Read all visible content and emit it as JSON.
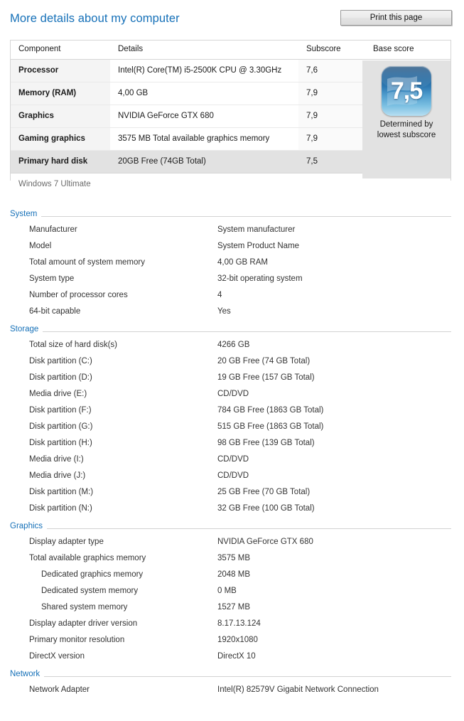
{
  "header": {
    "title": "More details about my computer",
    "print_button": "Print this page"
  },
  "score_table": {
    "columns": {
      "component": "Component",
      "details": "Details",
      "subscore": "Subscore",
      "base_score": "Base score"
    },
    "rows": [
      {
        "component": "Processor",
        "details": "Intel(R) Core(TM) i5-2500K CPU @ 3.30GHz",
        "subscore": "7,6",
        "highlight": false
      },
      {
        "component": "Memory (RAM)",
        "details": "4,00 GB",
        "subscore": "7,9",
        "highlight": false
      },
      {
        "component": "Graphics",
        "details": "NVIDIA GeForce GTX 680",
        "subscore": "7,9",
        "highlight": false
      },
      {
        "component": "Gaming graphics",
        "details": "3575 MB Total available graphics memory",
        "subscore": "7,9",
        "highlight": false
      },
      {
        "component": "Primary hard disk",
        "details": "20GB Free (74GB Total)",
        "subscore": "7,5",
        "highlight": true
      }
    ],
    "base_score_value": "7,5",
    "base_score_caption": "Determined by lowest subscore",
    "edition": "Windows 7 Ultimate"
  },
  "sections": [
    {
      "title": "System",
      "rows": [
        {
          "label": "Manufacturer",
          "value": "System manufacturer",
          "indent": false
        },
        {
          "label": "Model",
          "value": "System Product Name",
          "indent": false
        },
        {
          "label": "Total amount of system memory",
          "value": "4,00 GB RAM",
          "indent": false
        },
        {
          "label": "System type",
          "value": "32-bit operating system",
          "indent": false
        },
        {
          "label": "Number of processor cores",
          "value": "4",
          "indent": false
        },
        {
          "label": "64-bit capable",
          "value": "Yes",
          "indent": false
        }
      ]
    },
    {
      "title": "Storage",
      "rows": [
        {
          "label": "Total size of hard disk(s)",
          "value": "4266 GB",
          "indent": false
        },
        {
          "label": "Disk partition (C:)",
          "value": "20 GB Free (74 GB Total)",
          "indent": false
        },
        {
          "label": "Disk partition (D:)",
          "value": "19 GB Free (157 GB Total)",
          "indent": false
        },
        {
          "label": "Media drive (E:)",
          "value": "CD/DVD",
          "indent": false
        },
        {
          "label": "Disk partition (F:)",
          "value": "784 GB Free (1863 GB Total)",
          "indent": false
        },
        {
          "label": "Disk partition (G:)",
          "value": "515 GB Free (1863 GB Total)",
          "indent": false
        },
        {
          "label": "Disk partition (H:)",
          "value": "98 GB Free (139 GB Total)",
          "indent": false
        },
        {
          "label": "Media drive (I:)",
          "value": "CD/DVD",
          "indent": false
        },
        {
          "label": "Media drive (J:)",
          "value": "CD/DVD",
          "indent": false
        },
        {
          "label": "Disk partition (M:)",
          "value": "25 GB Free (70 GB Total)",
          "indent": false
        },
        {
          "label": "Disk partition (N:)",
          "value": "32 GB Free (100 GB Total)",
          "indent": false
        }
      ]
    },
    {
      "title": "Graphics",
      "rows": [
        {
          "label": "Display adapter type",
          "value": "NVIDIA GeForce GTX 680",
          "indent": false
        },
        {
          "label": "Total available graphics memory",
          "value": "3575 MB",
          "indent": false
        },
        {
          "label": "Dedicated graphics memory",
          "value": "2048 MB",
          "indent": true
        },
        {
          "label": "Dedicated system memory",
          "value": "0 MB",
          "indent": true
        },
        {
          "label": "Shared system memory",
          "value": "1527 MB",
          "indent": true
        },
        {
          "label": "Display adapter driver version",
          "value": "8.17.13.124",
          "indent": false
        },
        {
          "label": "Primary monitor resolution",
          "value": "1920x1080",
          "indent": false
        },
        {
          "label": "DirectX version",
          "value": "DirectX 10",
          "indent": false
        }
      ]
    },
    {
      "title": "Network",
      "rows": [
        {
          "label": "Network Adapter",
          "value": "Intel(R) 82579V Gigabit Network Connection",
          "indent": false
        }
      ]
    }
  ],
  "colors": {
    "link_blue": "#1570b8",
    "badge_blue": "#13568f",
    "highlight_gray": "#e2e2e2"
  }
}
